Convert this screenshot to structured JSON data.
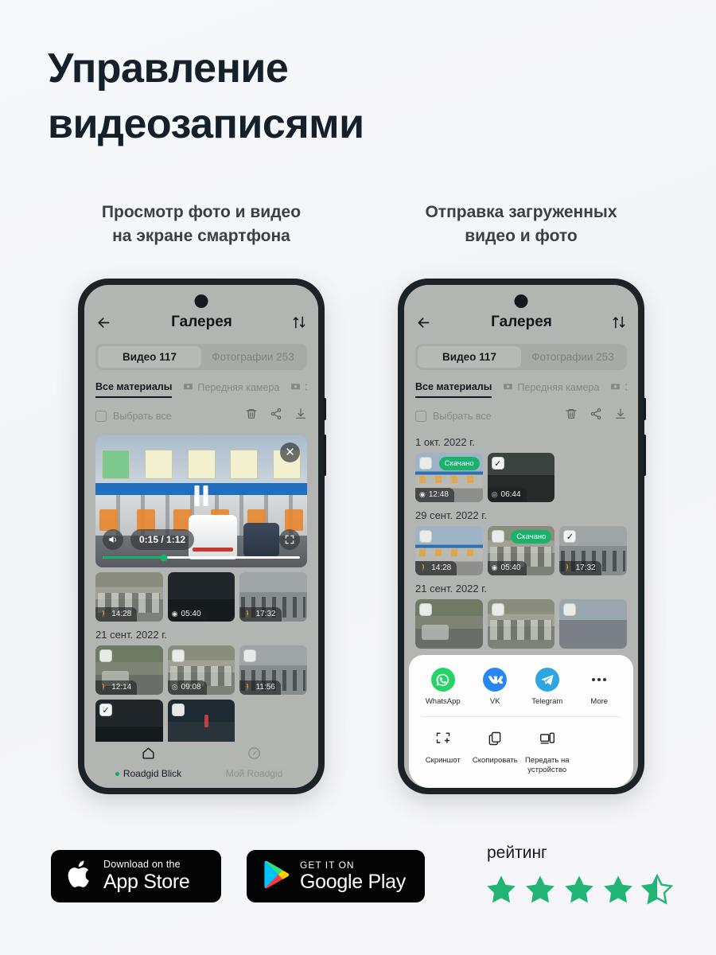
{
  "hero": {
    "title_line1": "Управление",
    "title_line2": "видеозаписями"
  },
  "columns": [
    {
      "subtitle_line1": "Просмотр фото и видео",
      "subtitle_line2": "на экране смартфона"
    },
    {
      "subtitle_line1": "Отправка загруженных",
      "subtitle_line2": "видео и фото"
    }
  ],
  "app": {
    "header": {
      "back_icon": "arrow-left-icon",
      "title": "Галерея",
      "sort_icon": "sort-arrows-icon"
    },
    "segments": [
      {
        "label": "Видео 117",
        "active": true
      },
      {
        "label": "Фотографии 253",
        "active": false
      }
    ],
    "filters": [
      {
        "label": "Все материалы",
        "icon": "",
        "active": true
      },
      {
        "label": "Передняя камера",
        "icon": "front-camera-icon",
        "active": false
      },
      {
        "label": "З",
        "icon": "rear-camera-icon",
        "active": false
      }
    ],
    "toolbar": {
      "select_all_label": "Выбрать все",
      "select_all_checked": false,
      "delete_icon": "trash-icon",
      "share_icon": "share-icon",
      "download_icon": "download-icon"
    },
    "nav": [
      {
        "label": "Roadgid Blick",
        "icon": "home-icon",
        "active": true
      },
      {
        "label": "Мой Roadgid",
        "icon": "speedometer-icon",
        "active": false
      }
    ]
  },
  "phone1": {
    "player": {
      "time": "0:15 / 1:12",
      "progress_percent": 31,
      "volume_icon": "volume-icon",
      "pause_icon": "pause-icon",
      "fullscreen_icon": "fullscreen-icon",
      "close_icon": "close-icon",
      "accent_color": "#19b06b"
    },
    "groups": [
      {
        "date": "",
        "items": [
          {
            "time": "14:28",
            "glyph": "walk",
            "scene": "traffic",
            "checked": false,
            "downloaded": false
          },
          {
            "time": "05:40",
            "glyph": "cam",
            "scene": "dark",
            "checked": false,
            "downloaded": false
          },
          {
            "time": "17:32",
            "glyph": "walk",
            "scene": "crowd",
            "checked": false,
            "downloaded": false
          }
        ]
      },
      {
        "date": "21 сент. 2022 г.",
        "items": [
          {
            "time": "12:14",
            "glyph": "walk",
            "scene": "street",
            "checked": false,
            "downloaded": false
          },
          {
            "time": "09:08",
            "glyph": "wifi",
            "scene": "traffic",
            "checked": false,
            "downloaded": false
          },
          {
            "time": "11:56",
            "glyph": "walk",
            "scene": "crowd",
            "checked": false,
            "downloaded": false
          }
        ]
      },
      {
        "date": "",
        "items": [
          {
            "time": "",
            "glyph": "",
            "scene": "dark",
            "checked": true,
            "downloaded": false
          },
          {
            "time": "",
            "glyph": "",
            "scene": "night",
            "checked": false,
            "downloaded": false
          },
          {
            "time": "",
            "glyph": "",
            "scene": "",
            "checked": false,
            "downloaded": false
          }
        ]
      }
    ]
  },
  "phone2": {
    "downloaded_badge": "Скачано",
    "groups": [
      {
        "date": "1 окт. 2022 г.",
        "items": [
          {
            "time": "12:48",
            "glyph": "cam",
            "scene": "toll",
            "checked": false,
            "downloaded": true
          },
          {
            "time": "06:44",
            "glyph": "wifi",
            "scene": "cabin",
            "checked": true,
            "downloaded": false
          },
          {
            "time": "",
            "glyph": "",
            "scene": "",
            "checked": false,
            "downloaded": false
          }
        ]
      },
      {
        "date": "29 сент. 2022 г.",
        "items": [
          {
            "time": "14:28",
            "glyph": "walk",
            "scene": "toll",
            "checked": false,
            "downloaded": false
          },
          {
            "time": "05:40",
            "glyph": "cam",
            "scene": "traffic",
            "checked": false,
            "downloaded": true
          },
          {
            "time": "17:32",
            "glyph": "walk",
            "scene": "crowd",
            "checked": true,
            "downloaded": false
          }
        ]
      },
      {
        "date": "21 сент. 2022 г.",
        "items": [
          {
            "time": "",
            "glyph": "",
            "scene": "street",
            "checked": false,
            "downloaded": false
          },
          {
            "time": "",
            "glyph": "",
            "scene": "traffic",
            "checked": false,
            "downloaded": false
          },
          {
            "time": "",
            "glyph": "",
            "scene": "road",
            "checked": false,
            "downloaded": false
          }
        ]
      }
    ],
    "share_sheet": {
      "apps": [
        {
          "name": "WhatsApp",
          "icon": "whatsapp-icon",
          "color": "#25d366"
        },
        {
          "name": "VK",
          "icon": "vk-icon",
          "color": "#2787f5"
        },
        {
          "name": "Telegram",
          "icon": "telegram-icon",
          "color": "#2ca5e0"
        },
        {
          "name": "More",
          "icon": "more-dots-icon",
          "color": "#30343a"
        }
      ],
      "actions": [
        {
          "name": "Скриншот",
          "icon": "screenshot-icon"
        },
        {
          "name": "Скопировать",
          "icon": "copy-icon"
        },
        {
          "name": "Передать\nна устройство",
          "icon": "cast-device-icon"
        }
      ]
    }
  },
  "footer": {
    "app_store": {
      "small": "Download on the",
      "large": "App Store",
      "icon": "apple-icon"
    },
    "google_play": {
      "small": "GET IT ON",
      "large": "Google Play",
      "icon": "google-play-icon"
    },
    "rating_label": "рейтинг",
    "rating_value": 4.5,
    "star_color": "#21b573"
  }
}
